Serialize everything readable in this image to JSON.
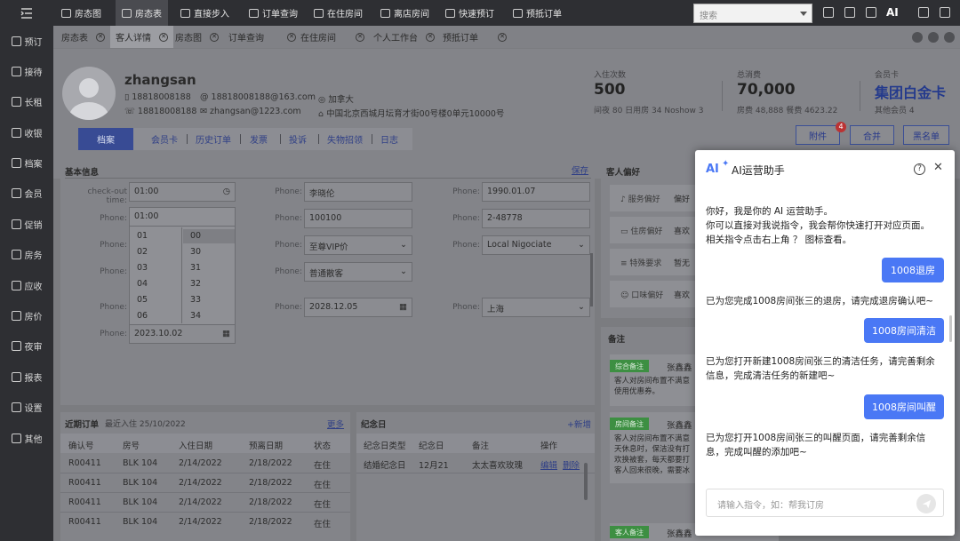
{
  "topbar": {
    "nav": [
      {
        "label": "房态图",
        "icon": "grid-icon"
      },
      {
        "label": "房态表",
        "icon": "table-icon"
      },
      {
        "label": "直接步入",
        "icon": "walk-in-icon"
      },
      {
        "label": "订单查询",
        "icon": "search-order-icon"
      },
      {
        "label": "在住房间",
        "icon": "home-icon"
      },
      {
        "label": "离店房间",
        "icon": "home-out-icon"
      },
      {
        "label": "快速预订",
        "icon": "flash-icon"
      },
      {
        "label": "预抵订单",
        "icon": "arrival-icon"
      }
    ],
    "search_placeholder": "搜索",
    "ai_label": "AI"
  },
  "sidebar": {
    "items": [
      {
        "label": "预订",
        "icon": "booking-icon"
      },
      {
        "label": "接待",
        "icon": "reception-icon"
      },
      {
        "label": "长租",
        "icon": "long-rent-icon"
      },
      {
        "label": "收银",
        "icon": "cashier-icon"
      },
      {
        "label": "档案",
        "icon": "archive-icon"
      },
      {
        "label": "会员",
        "icon": "member-icon"
      },
      {
        "label": "促销",
        "icon": "promo-icon"
      },
      {
        "label": "房务",
        "icon": "housekeeping-icon"
      },
      {
        "label": "应收",
        "icon": "receivable-icon"
      },
      {
        "label": "房价",
        "icon": "price-icon"
      },
      {
        "label": "夜审",
        "icon": "night-audit-icon"
      },
      {
        "label": "报表",
        "icon": "report-icon"
      },
      {
        "label": "设置",
        "icon": "settings-icon"
      },
      {
        "label": "其他",
        "icon": "more-icon"
      }
    ]
  },
  "tabs": [
    {
      "label": "房态表"
    },
    {
      "label": "客人详情"
    },
    {
      "label": "房态图"
    },
    {
      "label": "订单查询"
    },
    {
      "label": "在住房间"
    },
    {
      "label": "个人工作台"
    },
    {
      "label": "预抵订单"
    }
  ],
  "guest": {
    "name": "zhangsan",
    "mobile": "18818008188",
    "phone": "18818008188",
    "email1": "18818008188@163.com",
    "email2": "zhangsan@1223.com",
    "country": "加拿大",
    "address": "中国北京西城月坛育才街00号楼0单元10000号"
  },
  "stats": {
    "checkin_label": "入住次数",
    "checkin_value": "500",
    "checkin_sub": "间夜 80  日用房 34  Noshow 3",
    "spend_label": "总消费",
    "spend_value": "70,000",
    "spend_sub": "房费 48,888     餐费 4623.22",
    "card_label": "会员卡",
    "card_value": "集团白金卡",
    "card_sub": "其他会员 4"
  },
  "actions": {
    "attach": "附件",
    "attach_badge": "4",
    "merge": "合并",
    "blacklist": "黑名单"
  },
  "subtabs": [
    "档案",
    "会员卡",
    "历史订单",
    "发票",
    "投诉",
    "失物招领",
    "日志"
  ],
  "basic": {
    "title": "基本信息",
    "save": "保存",
    "checkout_label": "check-out time:",
    "checkout_value": "01:00",
    "picker_value": "01:00",
    "hours": [
      "01",
      "02",
      "03",
      "04",
      "05",
      "06"
    ],
    "minutes": [
      "00",
      "30",
      "31",
      "32",
      "33",
      "34"
    ],
    "phone_label": "Phone:",
    "date1": "2023.10.02",
    "col2": [
      "李晓伦",
      "100100",
      "至尊VIP价",
      "普通散客",
      "2028.12.05"
    ],
    "col3": [
      "1990.01.07",
      "2-48778",
      "Local Nigociate",
      "上海"
    ]
  },
  "prefs": {
    "title": "客人偏好",
    "rows": [
      {
        "label": "服务偏好",
        "value": "偏好"
      },
      {
        "label": "住房偏好",
        "value": "喜欢"
      },
      {
        "label": "特殊要求",
        "value": "暂无"
      },
      {
        "label": "口味偏好",
        "value": "喜欢"
      }
    ]
  },
  "notes": {
    "title": "备注",
    "items": [
      {
        "tag": "综合备注",
        "author": "张鑫鑫",
        "text": "客人对房间布置不满意\n使用优惠券。"
      },
      {
        "tag": "房间备注",
        "author": "张鑫鑫",
        "text": "客人对房间布置不满意\n天休息时，保洁没有打\n欢换被套，每天都要打\n客人回来很晚，需要冰"
      },
      {
        "tag": "客人备注",
        "author": "张鑫鑫",
        "text": ""
      }
    ]
  },
  "orders": {
    "title": "近期订单",
    "subtitle": "最近入住 25/10/2022",
    "more": "更多",
    "headers": [
      "确认号",
      "房号",
      "入住日期",
      "预离日期",
      "状态"
    ],
    "rows": [
      [
        "R00411",
        "BLK 104",
        "2/14/2022",
        "2/18/2022",
        "在住"
      ],
      [
        "R00411",
        "BLK 104",
        "2/14/2022",
        "2/18/2022",
        "在住"
      ],
      [
        "R00411",
        "BLK 104",
        "2/14/2022",
        "2/18/2022",
        "在住"
      ],
      [
        "R00411",
        "BLK 104",
        "2/14/2022",
        "2/18/2022",
        "在住"
      ]
    ]
  },
  "anniv": {
    "title": "纪念日",
    "add": "+新增",
    "headers": [
      "纪念日类型",
      "纪念日",
      "备注",
      "操作"
    ],
    "row": [
      "结婚纪念日",
      "12月21",
      "太太喜欢玫瑰"
    ],
    "edit": "编辑",
    "del": "删除"
  },
  "ai": {
    "logo": "AI",
    "title": "AI运营助手",
    "intro": [
      "你好，我是你的 AI 运营助手。",
      "你可以直接对我说指令，我会帮你快速打开对应页面。",
      "相关指令点击右上角 ？ 图标查看。"
    ],
    "messages": [
      {
        "user": "1008退房",
        "reply": "已为您完成1008房间张三的退房，请完成退房确认吧~"
      },
      {
        "user": "1008房间清洁",
        "reply": "已为您打开新建1008房间张三的清洁任务，请完善剩余信息，完成清洁任务的新建吧~"
      },
      {
        "user": "1008房间叫醒",
        "reply": "已为您打开1008房间张三的叫醒页面，请完善剩余信息，完成叫醒的添加吧~"
      }
    ],
    "input_placeholder": "请输入指令，如：帮我订房",
    "accent": "#4a78f5"
  }
}
